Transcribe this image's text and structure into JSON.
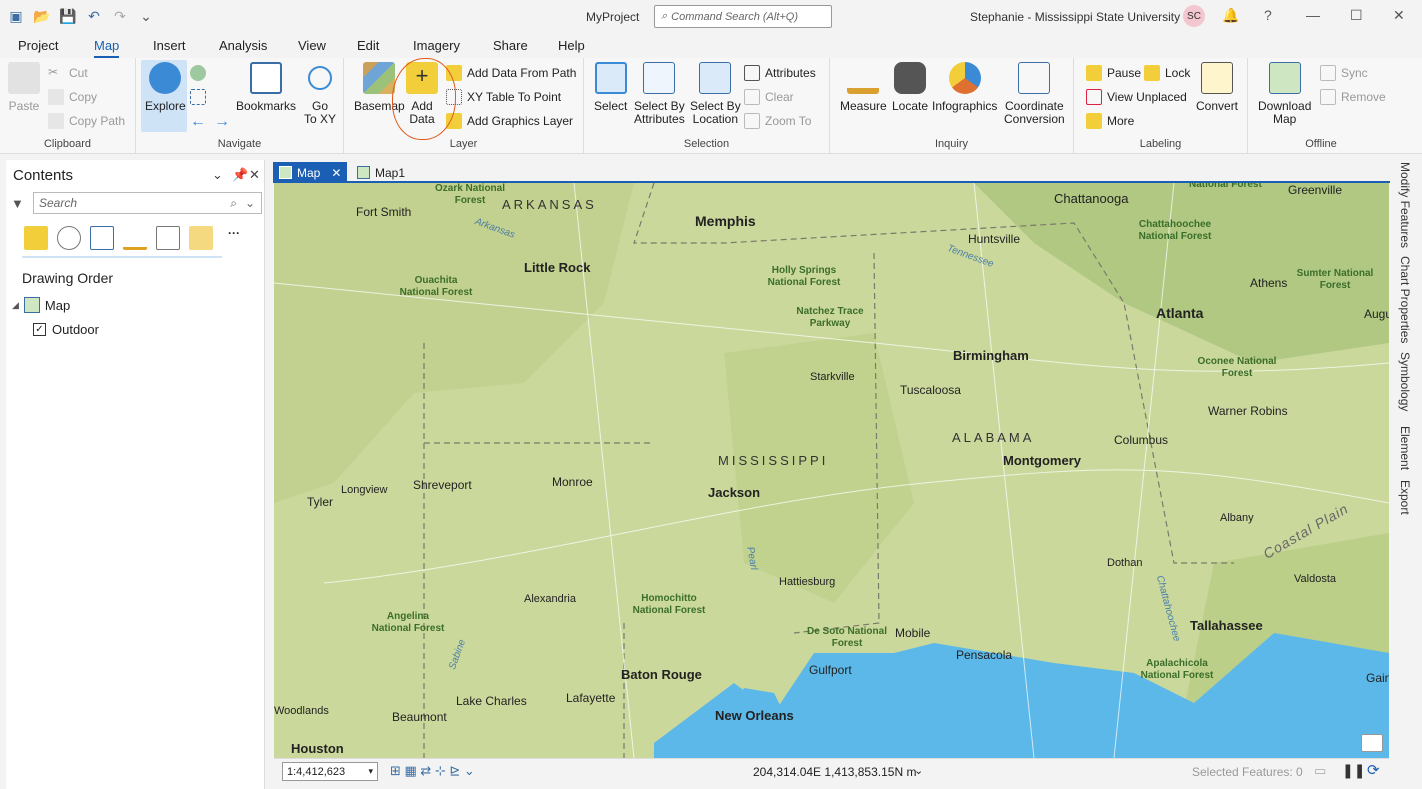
{
  "titlebar": {
    "project": "MyProject",
    "command_search_placeholder": "Command Search (Alt+Q)",
    "user": "Stephanie - Mississippi State University",
    "avatar_initials": "SC",
    "help": "?"
  },
  "tabs": [
    "Project",
    "Map",
    "Insert",
    "Analysis",
    "View",
    "Edit",
    "Imagery",
    "Share",
    "Help"
  ],
  "active_tab": "Map",
  "ribbon": {
    "clipboard": {
      "label": "Clipboard",
      "paste": "Paste",
      "cut": "Cut",
      "copy": "Copy",
      "copy_path": "Copy Path"
    },
    "navigate": {
      "label": "Navigate",
      "explore": "Explore",
      "bookmarks": "Bookmarks",
      "go_to_xy": "Go\nTo XY"
    },
    "layer": {
      "label": "Layer",
      "basemap": "Basemap",
      "add_data": "Add\nData",
      "add_data_from_path": "Add Data From Path",
      "xy_table_to_point": "XY Table To Point",
      "add_graphics_layer": "Add Graphics Layer"
    },
    "selection": {
      "label": "Selection",
      "select": "Select",
      "select_by_attributes": "Select By\nAttributes",
      "select_by_location": "Select By\nLocation",
      "attributes": "Attributes",
      "clear": "Clear",
      "zoom_to": "Zoom To"
    },
    "inquiry": {
      "label": "Inquiry",
      "measure": "Measure",
      "locate": "Locate",
      "infographics": "Infographics",
      "coordinate_conversion": "Coordinate\nConversion"
    },
    "labeling": {
      "label": "Labeling",
      "pause": "Pause",
      "lock": "Lock",
      "view_unplaced": "View Unplaced",
      "more": "More",
      "convert": "Convert"
    },
    "offline": {
      "label": "Offline",
      "download_map": "Download\nMap",
      "sync": "Sync",
      "remove": "Remove"
    }
  },
  "contents": {
    "title": "Contents",
    "search_placeholder": "Search",
    "drawing_order": "Drawing Order",
    "map_item": "Map",
    "layer_item": "Outdoor"
  },
  "map_tabs": [
    "Map",
    "Map1"
  ],
  "statusbar": {
    "scale": "1:4,412,623",
    "coordinates": "204,314.04E 1,413,853.15N m",
    "selected_features": "Selected Features: 0"
  },
  "side_tabs": [
    "Modify Features",
    "Chart Properties",
    "Symbology",
    "Element",
    "Export"
  ],
  "map_labels": {
    "cities": [
      "Fort Smith",
      "Memphis",
      "Little Rock",
      "Chattanooga",
      "Huntsville",
      "Greenville",
      "Athens",
      "Atlanta",
      "Augusta",
      "Birmingham",
      "Starkville",
      "Tuscaloosa",
      "Warner Robins",
      "Columbus",
      "Montgomery",
      "Jackson",
      "Monroe",
      "Shreveport",
      "Longview",
      "Tyler",
      "Albany",
      "Hattiesburg",
      "Alexandria",
      "Dothan",
      "Valdosta",
      "Tallahassee",
      "Mobile",
      "Pensacola",
      "Gulfport",
      "Baton Rouge",
      "Lafayette",
      "Lake Charles",
      "Beaumont",
      "New Orleans",
      "Houston",
      "Woodlands",
      "Gain"
    ],
    "states": [
      "ARKANSAS",
      "MISSISSIPPI",
      "ALABAMA"
    ],
    "forests": [
      "Ozark National Forest",
      "Ouachita National Forest",
      "Holly Springs National Forest",
      "Natchez Trace Parkway",
      "Chattahoochee National Forest",
      "Sumter National Forest",
      "Oconee National Forest",
      "Homochitto National Forest",
      "Angelina National Forest",
      "De Soto National Forest",
      "Apalachicola National Forest",
      "National Forest"
    ],
    "rivers": [
      "Arkansas",
      "Tennessee",
      "Pearl",
      "Sabine",
      "Chattahoochee"
    ],
    "region": "Coastal Plain"
  }
}
